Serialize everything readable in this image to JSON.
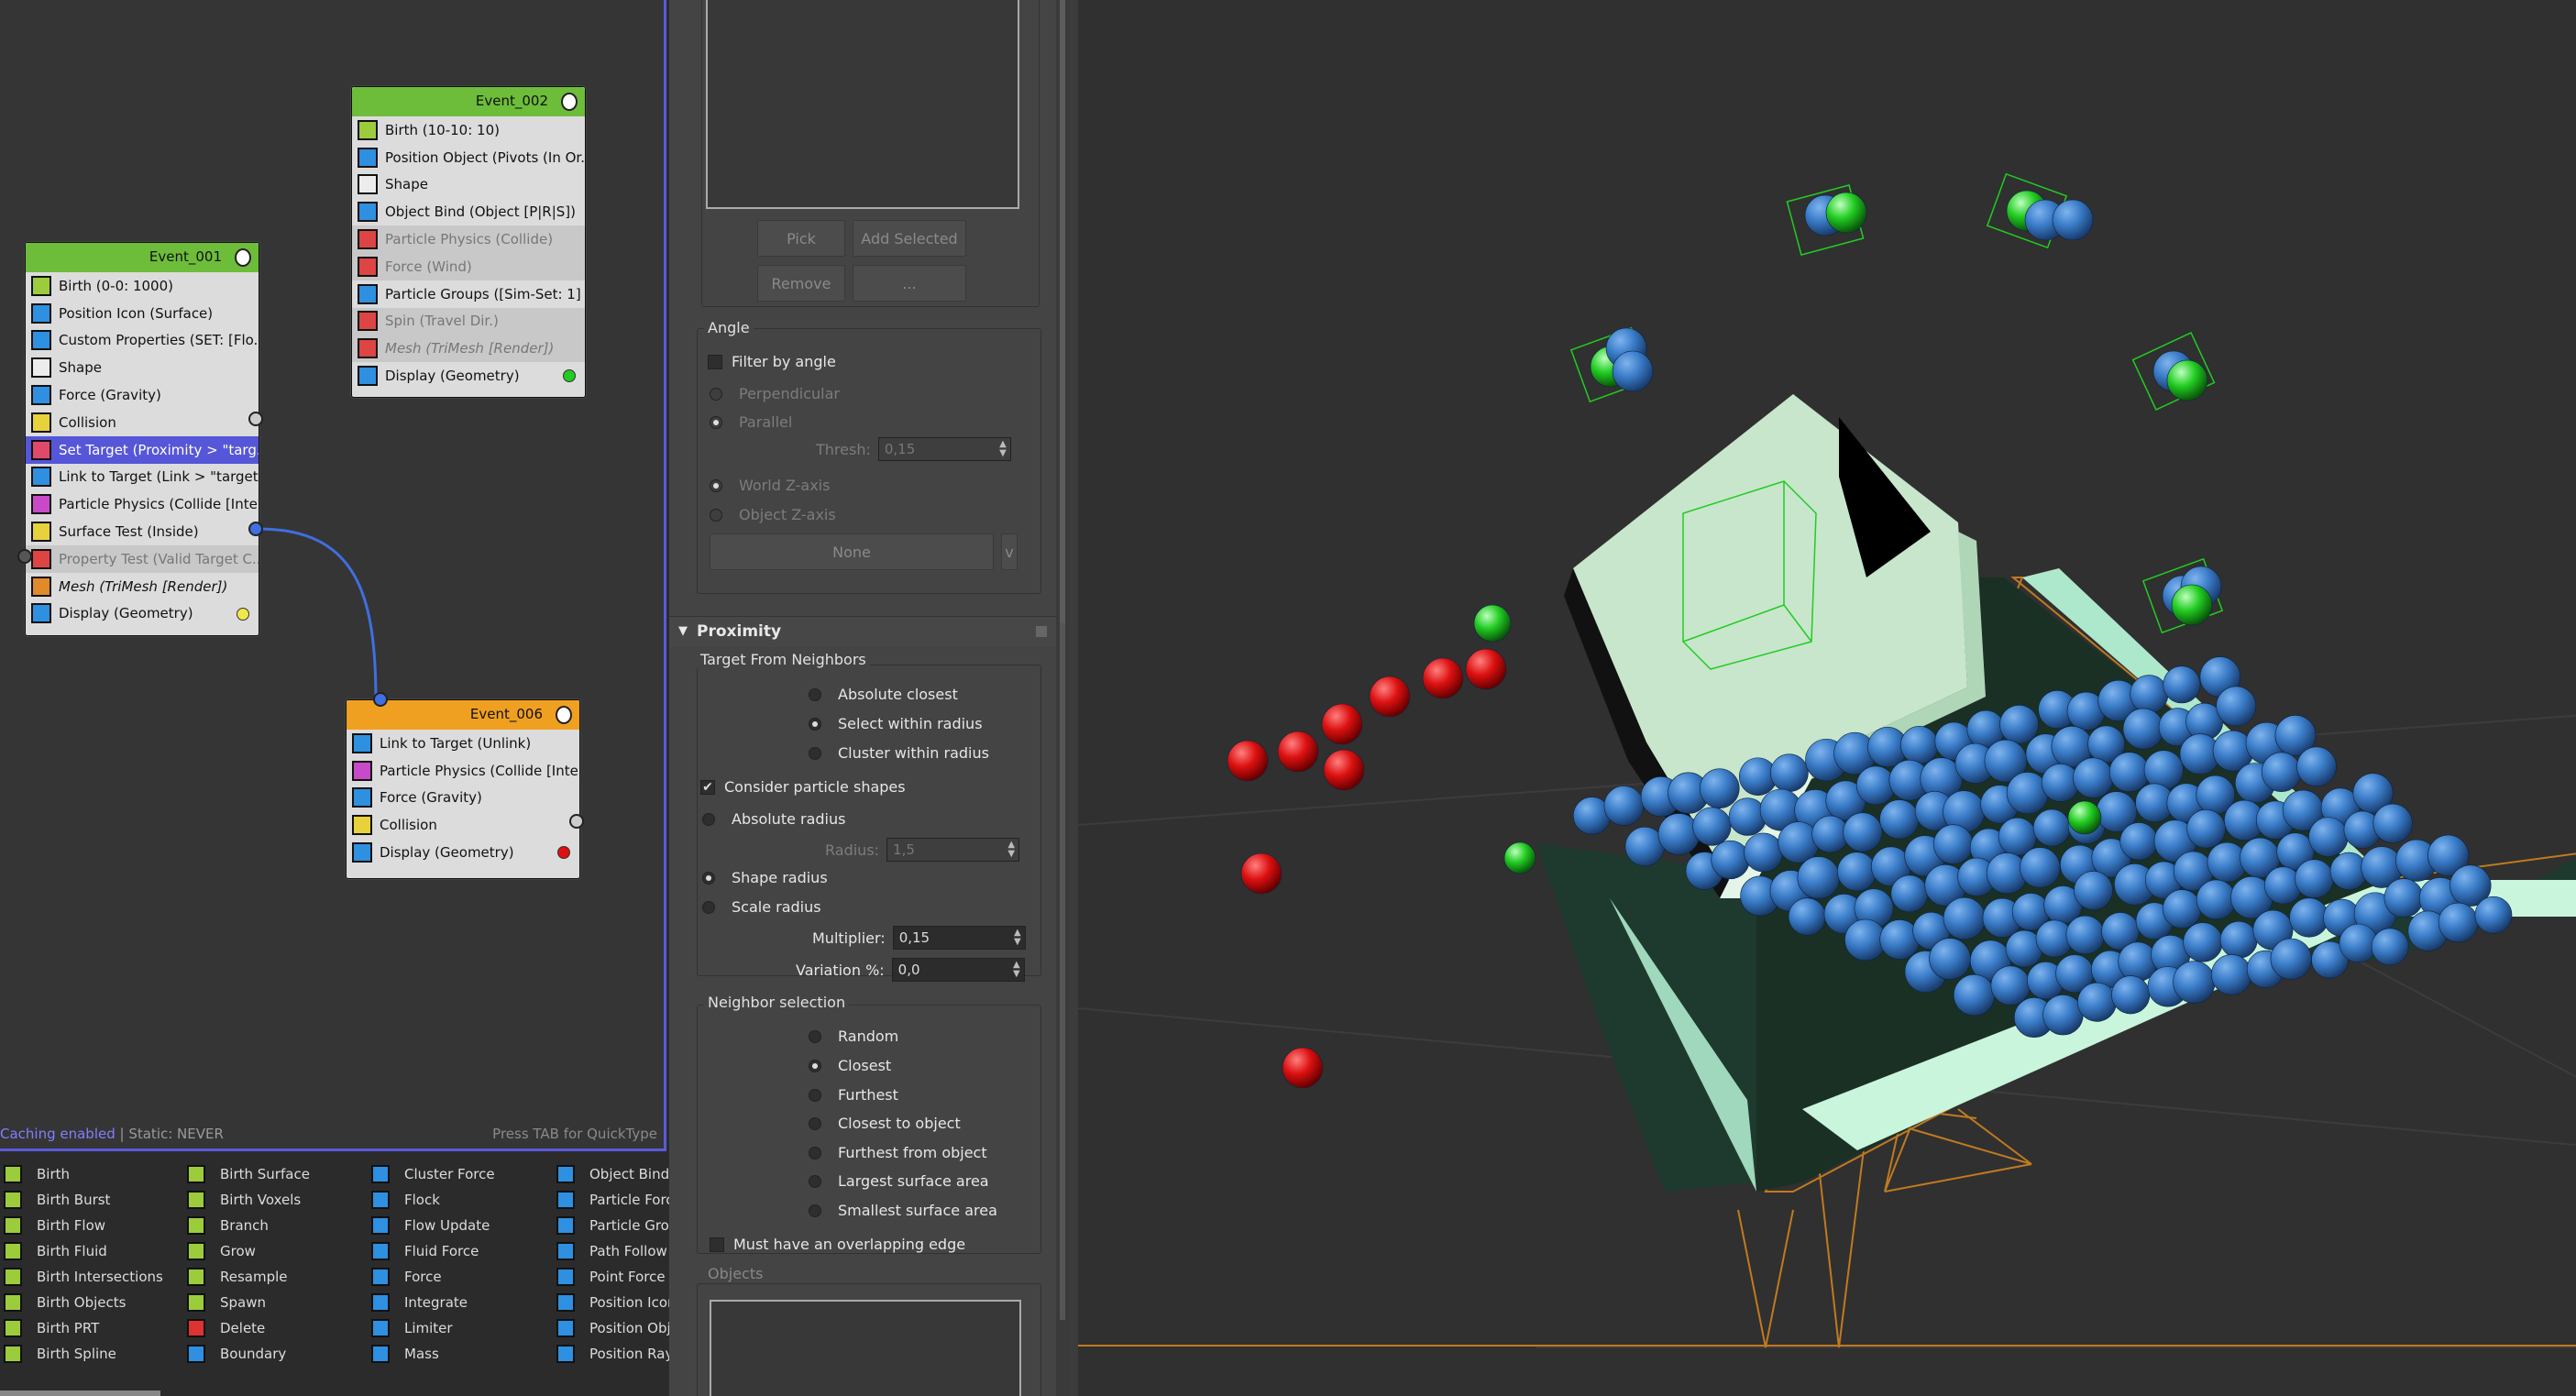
{
  "events": {
    "e002": {
      "title": "Event_002",
      "ops": [
        "Birth (10-10: 10)",
        "Position Object (Pivots (In Or...",
        "Shape",
        "Object Bind (Object [P|R|S])",
        "Particle Physics (Collide)",
        "Force (Wind)",
        "Particle Groups ([Sim-Set: 1] ...",
        "Spin (Travel Dir.)",
        "Mesh (TriMesh [Render])",
        "Display (Geometry)"
      ]
    },
    "e001": {
      "title": "Event_001",
      "ops": [
        "Birth (0-0: 1000)",
        "Position Icon (Surface)",
        "Custom Properties (SET: [Flo...",
        "Shape",
        "Force (Gravity)",
        "Collision",
        "Set Target (Proximity > \"targ...",
        "Link to Target (Link > \"target\")",
        "Particle Physics (Collide [Inte...",
        "Surface Test (Inside)",
        "Property Test (Valid Target C...",
        "Mesh (TriMesh [Render])",
        "Display (Geometry)"
      ]
    },
    "e006": {
      "title": "Event_006",
      "ops": [
        "Link to Target (Unlink)",
        "Particle Physics (Collide [Inte...",
        "Force (Gravity)",
        "Collision",
        "Display (Geometry)"
      ]
    }
  },
  "status": {
    "caching": "Caching enabled",
    "static": " | Static: NEVER",
    "hint": "Press TAB for QuickType"
  },
  "depot": {
    "col1": [
      "Birth",
      "Birth Burst",
      "Birth Flow",
      "Birth Fluid",
      "Birth Intersections",
      "Birth Objects",
      "Birth PRT",
      "Birth Spline"
    ],
    "col2": [
      "Birth Surface",
      "Birth Voxels",
      "Branch",
      "Grow",
      "Resample",
      "Spawn",
      "Delete",
      "Boundary"
    ],
    "col3": [
      "Cluster Force",
      "Flock",
      "Flow Update",
      "Fluid Force",
      "Force",
      "Integrate",
      "Limiter",
      "Mass"
    ],
    "col4": [
      "Object Bind",
      "Particle Forc",
      "Particle Grou",
      "Path Follow",
      "Point Force",
      "Position Icon",
      "Position Obj",
      "Position Ray"
    ]
  },
  "panel": {
    "buttons": {
      "pick": "Pick",
      "add_selected": "Add Selected",
      "remove": "Remove",
      "more": "...",
      "none": "None",
      "v": "v"
    },
    "angle": {
      "title": "Angle",
      "filter": "Filter by angle",
      "perpendicular": "Perpendicular",
      "parallel": "Parallel",
      "thresh_label": "Thresh:",
      "thresh_value": "0,15",
      "world_z": "World Z-axis",
      "object_z": "Object Z-axis"
    },
    "proximity": {
      "title": "Proximity",
      "target_group": "Target From Neighbors",
      "absolute_closest": "Absolute closest",
      "select_within": "Select within radius",
      "cluster_within": "Cluster within radius",
      "consider_shapes": "Consider particle shapes",
      "absolute_radius": "Absolute radius",
      "radius_label": "Radius:",
      "radius_value": "1,5",
      "shape_radius": "Shape radius",
      "scale_radius": "Scale radius",
      "multiplier_label": "Multiplier:",
      "multiplier_value": "0,15",
      "variation_label": "Variation %:",
      "variation_value": "0,0",
      "neighbor_group": "Neighbor selection",
      "random": "Random",
      "closest": "Closest",
      "furthest": "Furthest",
      "closest_obj": "Closest to object",
      "furthest_obj": "Furthest from object",
      "largest": "Largest surface area",
      "smallest": "Smallest surface area",
      "overlap": "Must have an overlapping edge",
      "objects": "Objects"
    }
  },
  "colors": {
    "event_green": "#6dbd3a",
    "event_orange": "#f0a020",
    "selection": "#5656d8",
    "wire": "#3f6fe0",
    "particle_blue": "#3a7cc8",
    "particle_green": "#22cc22",
    "particle_red": "#dd1111",
    "mesh": "#bff0d8"
  }
}
